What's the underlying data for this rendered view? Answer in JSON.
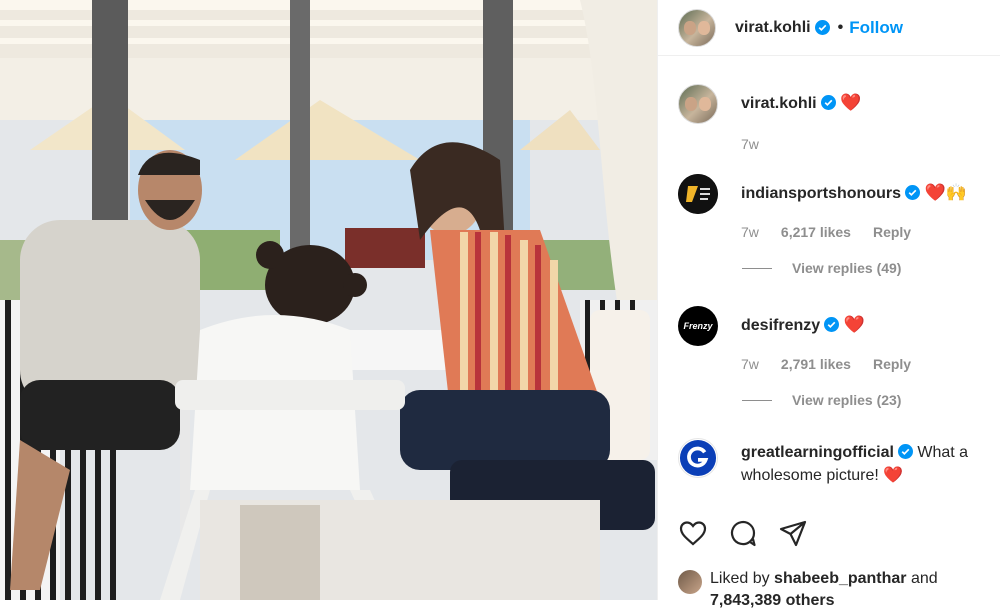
{
  "header": {
    "username": "virat.kohli",
    "follow_label": "Follow",
    "separator": "•"
  },
  "caption": {
    "username": "virat.kohli",
    "text": "❤️",
    "time": "7w"
  },
  "comments": [
    {
      "username": "indiansportshonours",
      "text": "❤️🙌",
      "time": "7w",
      "likes": "6,217 likes",
      "reply_label": "Reply",
      "view_replies": "View replies (49)"
    },
    {
      "username": "desifrenzy",
      "text": "❤️",
      "time": "7w",
      "likes": "2,791 likes",
      "reply_label": "Reply",
      "view_replies": "View replies (23)",
      "avatar_text": "Frenzy"
    },
    {
      "username": "greatlearningofficial",
      "text": "What a wholesome picture! ❤️"
    }
  ],
  "liked_by": {
    "prefix": "Liked by",
    "user": "shabeeb_panthar",
    "suffix": "and",
    "count_line": "7,843,389 others"
  },
  "colors": {
    "accent": "#0095f6",
    "verified": "#0095f6",
    "heart": "#ed1c24",
    "muted": "#8e8e8e"
  }
}
